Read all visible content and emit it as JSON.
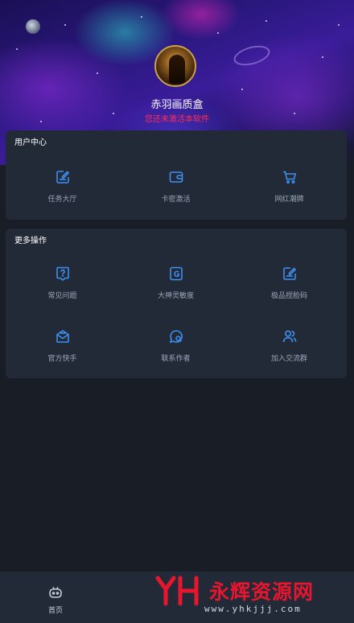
{
  "header": {
    "app_name": "赤羽画质盒",
    "activation_status": "您还未激活本软件"
  },
  "user_center": {
    "title": "用户中心",
    "items": [
      {
        "label": "任务大厅",
        "icon": "task-hall-icon"
      },
      {
        "label": "卡密激活",
        "icon": "card-key-icon"
      },
      {
        "label": "网红潮牌",
        "icon": "shopping-cart-icon"
      }
    ]
  },
  "more_actions": {
    "title": "更多操作",
    "items": [
      {
        "label": "常见问题",
        "icon": "help-icon"
      },
      {
        "label": "大神灵敏度",
        "icon": "sensitivity-icon"
      },
      {
        "label": "极品捏脸码",
        "icon": "face-code-icon"
      },
      {
        "label": "官方快手",
        "icon": "kuaishou-icon"
      },
      {
        "label": "联系作者",
        "icon": "contact-icon"
      },
      {
        "label": "加入交流群",
        "icon": "group-icon"
      }
    ]
  },
  "bottom_nav": {
    "home_label": "首页"
  },
  "watermark": {
    "brand": "永辉资源网",
    "url": "www.yhkjjj.com"
  },
  "colors": {
    "accent": "#3d8ff0",
    "warning": "#ff2f52",
    "card_bg": "#232a37",
    "page_bg": "#181d26"
  }
}
